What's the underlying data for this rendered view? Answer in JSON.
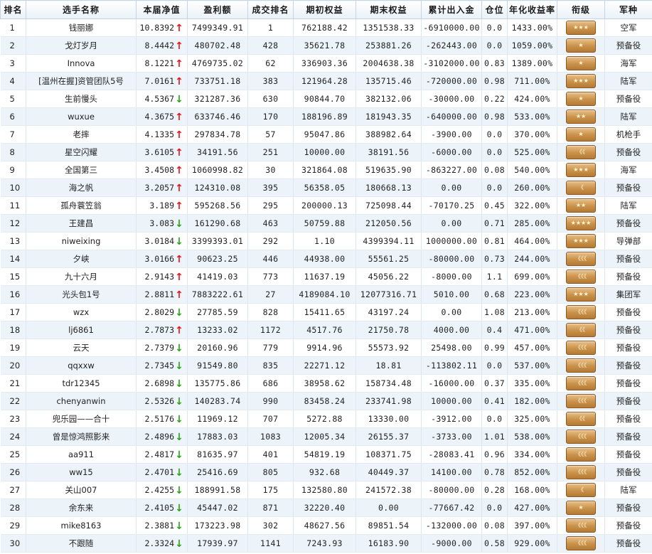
{
  "headers": [
    "排名",
    "选手名称",
    "本届净值",
    "盈利额",
    "成交排名",
    "期初权益",
    "期末权益",
    "累计出入金",
    "仓位",
    "年化收益率",
    "衔级",
    "军种"
  ],
  "rows": [
    {
      "rank": "1",
      "name": "钱丽娜",
      "nav": "10.8392",
      "trend": "up",
      "profit": "7499349.91",
      "trade_rank": "1",
      "init_equity": "762188.42",
      "end_equity": "1351538.33",
      "cum_flow": "-6910000.00",
      "position": "0.0",
      "annual": "1433.00%",
      "rank_badge": "★★★",
      "branch": "空军"
    },
    {
      "rank": "2",
      "name": "戈灯岁月",
      "nav": "8.4442",
      "trend": "up",
      "profit": "480702.48",
      "trade_rank": "428",
      "init_equity": "35621.78",
      "end_equity": "253881.26",
      "cum_flow": "-262443.00",
      "position": "0.0",
      "annual": "1059.00%",
      "rank_badge": "★",
      "branch": "预备役"
    },
    {
      "rank": "3",
      "name": "Innova",
      "nav": "8.1221",
      "trend": "up",
      "profit": "4769735.02",
      "trade_rank": "62",
      "init_equity": "336903.36",
      "end_equity": "2004638.38",
      "cum_flow": "-3102000.00",
      "position": "0.83",
      "annual": "1389.00%",
      "rank_badge": "★",
      "branch": "海军"
    },
    {
      "rank": "4",
      "name": "[温州在握]资管团队5号",
      "nav": "7.0161",
      "trend": "up",
      "profit": "733751.18",
      "trade_rank": "383",
      "init_equity": "121964.28",
      "end_equity": "135715.46",
      "cum_flow": "-720000.00",
      "position": "0.98",
      "annual": "711.00%",
      "rank_badge": "★★★",
      "branch": "陆军"
    },
    {
      "rank": "5",
      "name": "生前慢头",
      "nav": "4.5367",
      "trend": "down",
      "profit": "321287.36",
      "trade_rank": "630",
      "init_equity": "90844.70",
      "end_equity": "382132.06",
      "cum_flow": "-30000.00",
      "position": "0.22",
      "annual": "424.00%",
      "rank_badge": "★",
      "branch": "预备役"
    },
    {
      "rank": "6",
      "name": "wuxue",
      "nav": "4.3675",
      "trend": "up",
      "profit": "633746.46",
      "trade_rank": "170",
      "init_equity": "188196.89",
      "end_equity": "181943.35",
      "cum_flow": "-640000.00",
      "position": "0.98",
      "annual": "533.00%",
      "rank_badge": "★★",
      "branch": "陆军"
    },
    {
      "rank": "7",
      "name": "老摔",
      "nav": "4.1335",
      "trend": "up",
      "profit": "297834.78",
      "trade_rank": "57",
      "init_equity": "95047.86",
      "end_equity": "388982.64",
      "cum_flow": "-3900.00",
      "position": "0.0",
      "annual": "370.00%",
      "rank_badge": "★",
      "branch": "机枪手"
    },
    {
      "rank": "8",
      "name": "星空闪耀",
      "nav": "3.6105",
      "trend": "up",
      "profit": "34191.56",
      "trade_rank": "251",
      "init_equity": "10000.00",
      "end_equity": "38191.56",
      "cum_flow": "-6000.00",
      "position": "0.0",
      "annual": "525.00%",
      "rank_badge": "《《",
      "branch": "预备役"
    },
    {
      "rank": "9",
      "name": "全国第三",
      "nav": "3.4508",
      "trend": "up",
      "profit": "1060998.82",
      "trade_rank": "30",
      "init_equity": "321864.08",
      "end_equity": "519635.90",
      "cum_flow": "-863227.00",
      "position": "0.08",
      "annual": "540.00%",
      "rank_badge": "★★★",
      "branch": "海军"
    },
    {
      "rank": "10",
      "name": "海之帆",
      "nav": "3.2057",
      "trend": "up",
      "profit": "124310.08",
      "trade_rank": "395",
      "init_equity": "56358.05",
      "end_equity": "180668.13",
      "cum_flow": "0.00",
      "position": "0.0",
      "annual": "260.00%",
      "rank_badge": "《",
      "branch": "预备役"
    },
    {
      "rank": "11",
      "name": "孤舟蓑笠翁",
      "nav": "3.189",
      "trend": "up",
      "profit": "595268.56",
      "trade_rank": "295",
      "init_equity": "200000.13",
      "end_equity": "725098.44",
      "cum_flow": "-70170.25",
      "position": "0.45",
      "annual": "322.00%",
      "rank_badge": "★★",
      "branch": "陆军"
    },
    {
      "rank": "12",
      "name": "王建昌",
      "nav": "3.083",
      "trend": "down",
      "profit": "161290.68",
      "trade_rank": "463",
      "init_equity": "50759.88",
      "end_equity": "212050.56",
      "cum_flow": "0.00",
      "position": "0.71",
      "annual": "285.00%",
      "rank_badge": "★★★★",
      "branch": "预备役"
    },
    {
      "rank": "13",
      "name": "niweixing",
      "nav": "3.0184",
      "trend": "down",
      "profit": "3399393.01",
      "trade_rank": "292",
      "init_equity": "1.10",
      "end_equity": "4399394.11",
      "cum_flow": "1000000.00",
      "position": "0.81",
      "annual": "464.00%",
      "rank_badge": "★★★",
      "branch": "导弹部"
    },
    {
      "rank": "14",
      "name": "夕峡",
      "nav": "3.0166",
      "trend": "up",
      "profit": "90623.25",
      "trade_rank": "446",
      "init_equity": "44938.00",
      "end_equity": "55561.25",
      "cum_flow": "-80000.00",
      "position": "0.73",
      "annual": "244.00%",
      "rank_badge": "《《《",
      "branch": "预备役"
    },
    {
      "rank": "15",
      "name": "九十六月",
      "nav": "2.9143",
      "trend": "up",
      "profit": "41419.03",
      "trade_rank": "773",
      "init_equity": "11637.19",
      "end_equity": "45056.22",
      "cum_flow": "-8000.00",
      "position": "1.1",
      "annual": "699.00%",
      "rank_badge": "《《《",
      "branch": "预备役"
    },
    {
      "rank": "16",
      "name": "光头包1号",
      "nav": "2.8811",
      "trend": "up",
      "profit": "7883222.61",
      "trade_rank": "27",
      "init_equity": "4189084.10",
      "end_equity": "12077316.71",
      "cum_flow": "5010.00",
      "position": "0.68",
      "annual": "223.00%",
      "rank_badge": "★★★",
      "branch": "集团军"
    },
    {
      "rank": "17",
      "name": "wzx",
      "nav": "2.8029",
      "trend": "down",
      "profit": "27785.59",
      "trade_rank": "828",
      "init_equity": "15411.65",
      "end_equity": "43197.24",
      "cum_flow": "0.00",
      "position": "1.08",
      "annual": "213.00%",
      "rank_badge": "《《《",
      "branch": "预备役"
    },
    {
      "rank": "18",
      "name": "lj6861",
      "nav": "2.7873",
      "trend": "up",
      "profit": "13233.02",
      "trade_rank": "1172",
      "init_equity": "4517.76",
      "end_equity": "21750.78",
      "cum_flow": "4000.00",
      "position": "0.4",
      "annual": "471.00%",
      "rank_badge": "《《",
      "branch": "预备役"
    },
    {
      "rank": "19",
      "name": "云天",
      "nav": "2.7379",
      "trend": "down",
      "profit": "20160.96",
      "trade_rank": "779",
      "init_equity": "9914.96",
      "end_equity": "55573.92",
      "cum_flow": "25498.00",
      "position": "0.99",
      "annual": "457.00%",
      "rank_badge": "《《《",
      "branch": "预备役"
    },
    {
      "rank": "20",
      "name": "qqxxw",
      "nav": "2.7345",
      "trend": "down",
      "profit": "91549.80",
      "trade_rank": "835",
      "init_equity": "22271.12",
      "end_equity": "18.81",
      "cum_flow": "-113802.11",
      "position": "0.0",
      "annual": "537.00%",
      "rank_badge": "《《《",
      "branch": "预备役"
    },
    {
      "rank": "21",
      "name": "tdr12345",
      "nav": "2.6898",
      "trend": "down",
      "profit": "135775.86",
      "trade_rank": "686",
      "init_equity": "38958.62",
      "end_equity": "158734.48",
      "cum_flow": "-16000.00",
      "position": "0.37",
      "annual": "335.00%",
      "rank_badge": "《《《",
      "branch": "预备役"
    },
    {
      "rank": "22",
      "name": "chenyanwin",
      "nav": "2.5326",
      "trend": "down",
      "profit": "140283.74",
      "trade_rank": "990",
      "init_equity": "83458.24",
      "end_equity": "233741.98",
      "cum_flow": "10000.00",
      "position": "0.41",
      "annual": "182.00%",
      "rank_badge": "《《《",
      "branch": "预备役"
    },
    {
      "rank": "23",
      "name": "兜乐园——合十",
      "nav": "2.5176",
      "trend": "down",
      "profit": "11969.12",
      "trade_rank": "707",
      "init_equity": "5272.88",
      "end_equity": "13330.00",
      "cum_flow": "-3912.00",
      "position": "0.0",
      "annual": "325.00%",
      "rank_badge": "《《",
      "branch": "预备役"
    },
    {
      "rank": "24",
      "name": "曾是惊鸿照影来",
      "nav": "2.4896",
      "trend": "down",
      "profit": "17883.03",
      "trade_rank": "1083",
      "init_equity": "12005.34",
      "end_equity": "26155.37",
      "cum_flow": "-3733.00",
      "position": "1.01",
      "annual": "538.00%",
      "rank_badge": "《《《",
      "branch": "预备役"
    },
    {
      "rank": "25",
      "name": "aa911",
      "nav": "2.4817",
      "trend": "down",
      "profit": "81635.97",
      "trade_rank": "401",
      "init_equity": "54819.19",
      "end_equity": "108371.75",
      "cum_flow": "-28083.41",
      "position": "0.96",
      "annual": "334.00%",
      "rank_badge": "《《《",
      "branch": "预备役"
    },
    {
      "rank": "26",
      "name": "ww15",
      "nav": "2.4701",
      "trend": "down",
      "profit": "25416.69",
      "trade_rank": "805",
      "init_equity": "932.68",
      "end_equity": "40449.37",
      "cum_flow": "14100.00",
      "position": "0.78",
      "annual": "852.00%",
      "rank_badge": "《《《",
      "branch": "预备役"
    },
    {
      "rank": "27",
      "name": "关山007",
      "nav": "2.4255",
      "trend": "down",
      "profit": "188991.58",
      "trade_rank": "175",
      "init_equity": "132580.80",
      "end_equity": "241572.38",
      "cum_flow": "-80000.00",
      "position": "0.28",
      "annual": "168.00%",
      "rank_badge": "《",
      "branch": "陆军"
    },
    {
      "rank": "28",
      "name": "余东来",
      "nav": "2.4105",
      "trend": "down",
      "profit": "45447.02",
      "trade_rank": "871",
      "init_equity": "32220.40",
      "end_equity": "0.00",
      "cum_flow": "-77667.42",
      "position": "0.0",
      "annual": "427.00%",
      "rank_badge": "★",
      "branch": "预备役"
    },
    {
      "rank": "29",
      "name": "mike8163",
      "nav": "2.3881",
      "trend": "down",
      "profit": "173223.98",
      "trade_rank": "302",
      "init_equity": "48627.56",
      "end_equity": "89851.54",
      "cum_flow": "-132000.00",
      "position": "0.08",
      "annual": "397.00%",
      "rank_badge": "《《《",
      "branch": "预备役"
    },
    {
      "rank": "30",
      "name": "不跟随",
      "nav": "2.3324",
      "trend": "down",
      "profit": "17939.97",
      "trade_rank": "1141",
      "init_equity": "7243.93",
      "end_equity": "16183.90",
      "cum_flow": "-9000.00",
      "position": "0.58",
      "annual": "929.00%",
      "rank_badge": "《《《",
      "branch": "预备役"
    }
  ],
  "icons": {
    "up": "arrow-up-icon",
    "down": "arrow-down-icon",
    "badge": "rank-insignia-icon"
  },
  "colors": {
    "up": "#e8141b",
    "down": "#2aa516",
    "badge": "#c99149",
    "stripe": "#ecf4fa",
    "header": "#e9f1f8"
  }
}
